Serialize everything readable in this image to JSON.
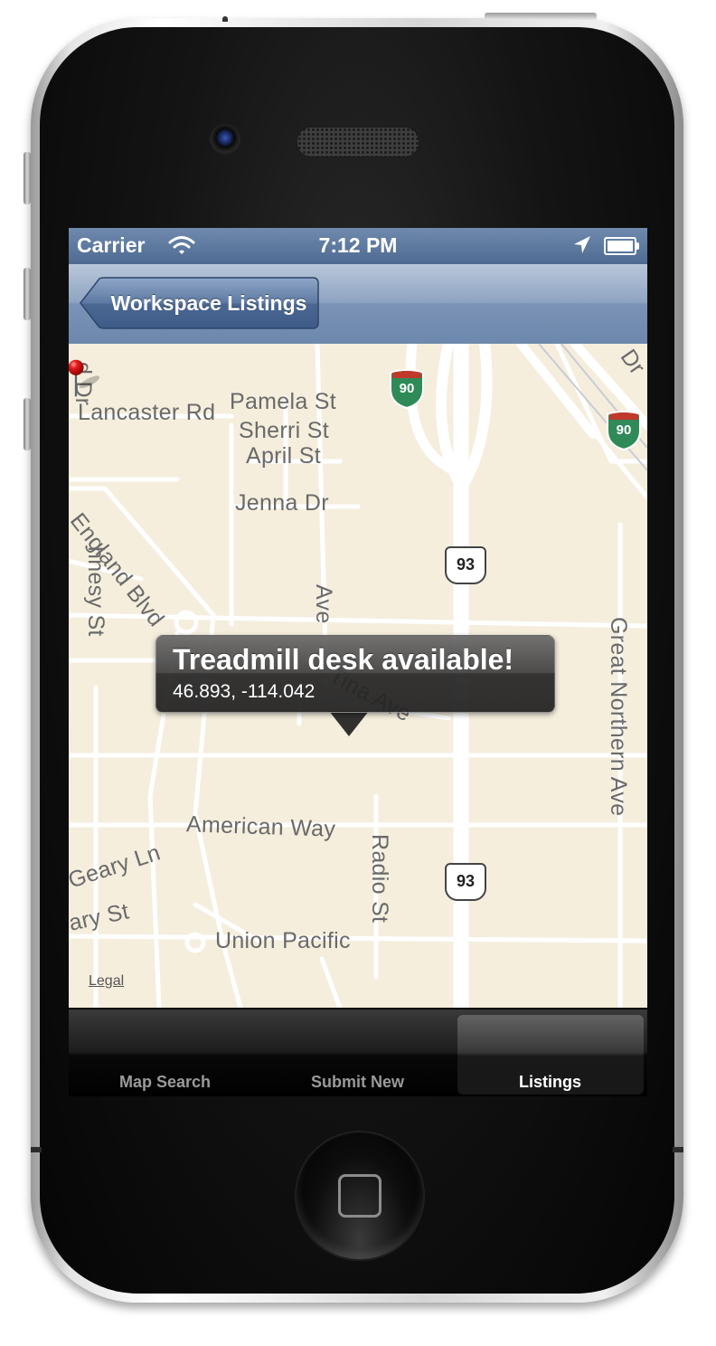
{
  "status_bar": {
    "carrier": "Carrier",
    "time": "7:12 PM",
    "icons": [
      "wifi-icon",
      "location-arrow-icon",
      "battery-icon"
    ]
  },
  "nav_bar": {
    "back_label": "Workspace Listings"
  },
  "map": {
    "streets": {
      "lancaster": "Lancaster Rd",
      "pamela": "Pamela St",
      "sherri": "Sherri St",
      "april": "April St",
      "jenna": "Jenna Dr",
      "england": "England Blvd",
      "shaughnesy": "hnesy St",
      "tina": "Tina Ave",
      "american": "American Way",
      "radio": "Radio St",
      "geary_ln": "Geary Ln",
      "geary_st": "ary St",
      "union": "Union Pacific",
      "great_northern": "Great Northern Ave",
      "d_dr": "d Dr",
      "top_dr": "Dr",
      "tina_ave_partial": "Ave"
    },
    "shields": {
      "interstate_1": "90",
      "interstate_2": "90",
      "us_1": "93",
      "us_2": "93"
    },
    "legal": "Legal",
    "callout": {
      "title": "Treadmill desk available!",
      "subtitle": "46.893, -114.042"
    }
  },
  "tab_bar": {
    "tabs": [
      {
        "label": "Map Search",
        "selected": false
      },
      {
        "label": "Submit New",
        "selected": false
      },
      {
        "label": "Listings",
        "selected": true
      }
    ]
  },
  "colors": {
    "map_background": "#f5eedd",
    "nav_bar": "#7a93b6",
    "status_bar": "#4e6a92",
    "interstate_shield": "#2f8a58"
  }
}
